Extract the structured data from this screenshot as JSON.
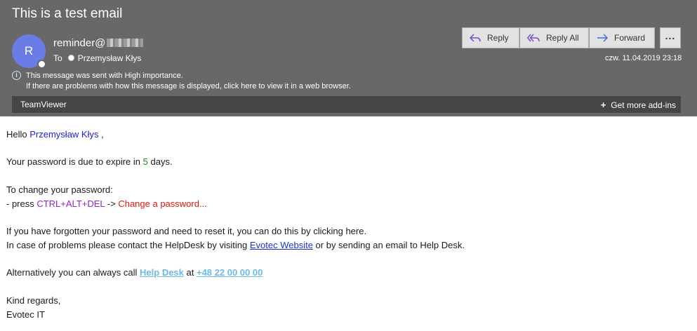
{
  "header": {
    "subject": "This is a test email",
    "avatar_initial": "R",
    "sender": "reminder@",
    "to_label": "To",
    "recipient": "Przemysław Kłys",
    "importance_text": "This message was sent with High importance.",
    "web_view_text": "If there are problems with how this message is displayed, click here to view it in a web browser.",
    "date": "czw. 11.04.2019 23:18"
  },
  "actions": {
    "reply": "Reply",
    "reply_all": "Reply All",
    "forward": "Forward",
    "more": "..."
  },
  "addins": {
    "name": "TeamViewer",
    "get_more": "Get more add-ins"
  },
  "body": {
    "greeting_prefix": "Hello ",
    "greeting_name": "Przemysław Kłys",
    "greeting_suffix": " ,",
    "expire_prefix": "Your password is due to expire in ",
    "expire_days": "5",
    "expire_suffix": " days.",
    "change_heading": "To change your password:",
    "press_prefix": "- press ",
    "press_keys": "CTRL+ALT+DEL",
    "press_arrow": " -> ",
    "press_action": "Change a password...",
    "forgot_text": "If you have forgotten your password and need to reset it, you can do this by clicking here.",
    "problems_prefix": "In case of problems please contact the HelpDesk by visiting ",
    "problems_link": "Evotec Website",
    "problems_suffix": " or by sending an email to Help Desk.",
    "call_prefix": "Alternatively you can always call ",
    "call_link": "Help Desk",
    "call_at": " at ",
    "call_phone": "+48 22 00 00 00",
    "regards": "Kind regards,",
    "signature": "Evotec IT"
  },
  "colors": {
    "header_bg": "#686868",
    "avatar": "#6b7ce6",
    "name": "#1f1fd1",
    "days": "#1d8a1d",
    "keys": "#9422c5",
    "action": "#e0190f",
    "link": "#1a33cc",
    "light_link": "#6bb8e6"
  }
}
